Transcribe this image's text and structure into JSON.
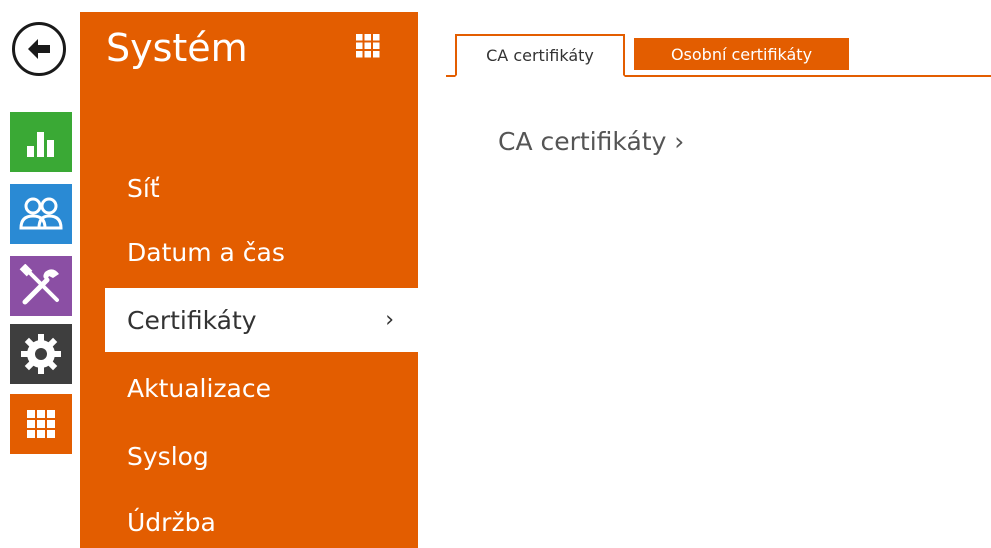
{
  "rail": {
    "back_icon": "arrow-left-icon",
    "tiles": [
      {
        "name": "status",
        "icon": "bar-chart-icon",
        "color": "#3aa935"
      },
      {
        "name": "users",
        "icon": "users-icon",
        "color": "#2a8ad4"
      },
      {
        "name": "services",
        "icon": "tools-icon",
        "color": "#8b4fa4"
      },
      {
        "name": "hardware",
        "icon": "gear-icon",
        "color": "#3e3e3e"
      },
      {
        "name": "system",
        "icon": "grid-icon",
        "color": "#e35d00"
      }
    ]
  },
  "menu": {
    "title": "Systém",
    "accent": "#e35d00",
    "items": [
      {
        "label": "Síť"
      },
      {
        "label": "Datum a čas"
      },
      {
        "label": "Certifikáty",
        "chevron": "›"
      },
      {
        "label": "Aktualizace"
      },
      {
        "label": "Syslog"
      },
      {
        "label": "Údržba"
      }
    ]
  },
  "tabs": [
    {
      "label": "CA certifikáty"
    },
    {
      "label": "Osobní certifikáty"
    }
  ],
  "content": {
    "section_label": "CA certifikáty ›"
  }
}
